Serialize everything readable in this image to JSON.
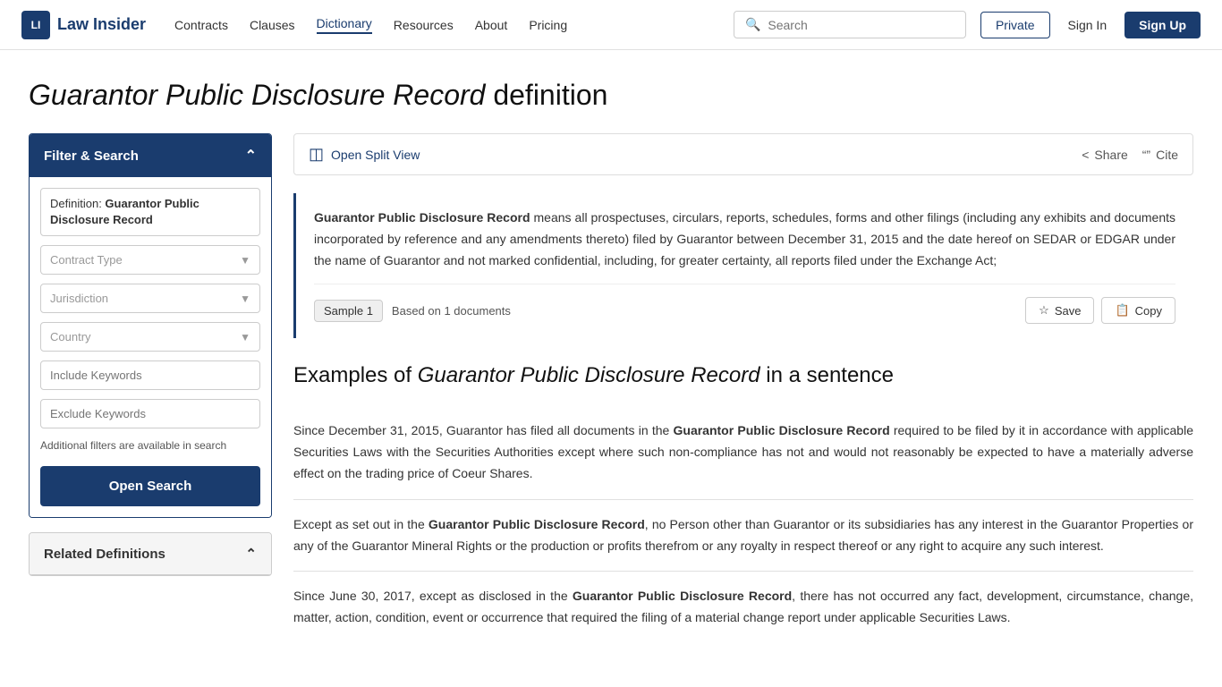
{
  "nav": {
    "logo_text": "Law Insider",
    "logo_icon": "LI",
    "links": [
      {
        "label": "Contracts",
        "active": false
      },
      {
        "label": "Clauses",
        "active": false
      },
      {
        "label": "Dictionary",
        "active": true
      },
      {
        "label": "Resources",
        "active": false
      },
      {
        "label": "About",
        "active": false
      },
      {
        "label": "Pricing",
        "active": false
      }
    ],
    "search_placeholder": "Search",
    "btn_private": "Private",
    "btn_signin": "Sign In",
    "btn_signup": "Sign Up"
  },
  "page_title_prefix": "",
  "page_title_italic": "Guarantor Public Disclosure Record",
  "page_title_suffix": " definition",
  "sidebar": {
    "filter_header": "Filter & Search",
    "definition_label": "Definition: ",
    "definition_value": "Guarantor Public Disclosure Record",
    "contract_type_placeholder": "Contract Type",
    "jurisdiction_placeholder": "Jurisdiction",
    "country_placeholder": "Country",
    "include_keywords_placeholder": "Include Keywords",
    "exclude_keywords_placeholder": "Exclude Keywords",
    "additional_filters": "Additional filters are available in search",
    "open_search_btn": "Open Search",
    "related_header": "Related Definitions"
  },
  "content": {
    "split_view_label": "Open Split View",
    "share_label": "Share",
    "cite_label": "Cite",
    "definition_bold": "Guarantor Public Disclosure Record",
    "definition_text": " means all prospectuses, circulars, reports, schedules, forms and other filings (including any exhibits and documents incorporated by reference and any amendments thereto) filed by Guarantor between December 31, 2015 and the date hereof on SEDAR or EDGAR under the name of Guarantor and not marked confidential, including, for greater certainty, all reports filed under the Exchange Act;",
    "sample_badge": "Sample 1",
    "based_on": "Based on 1 documents",
    "save_btn": "Save",
    "copy_btn": "Copy",
    "examples_heading_prefix": "Examples of ",
    "examples_heading_italic": "Guarantor Public Disclosure Record",
    "examples_heading_suffix": " in a sentence",
    "examples": [
      {
        "bold": "Guarantor Public Disclosure Record",
        "text_before": "Since December 31, 2015, Guarantor has filed all documents in the ",
        "text_after": " required to be filed by it in accordance with applicable Securities Laws with the Securities Authorities except where such non-compliance has not and would not reasonably be expected to have a materially adverse effect on the trading price of Coeur Shares."
      },
      {
        "bold": "Guarantor Public Disclosure Record",
        "text_before": "Except as set out in the ",
        "text_after": ", no Person other than Guarantor or its subsidiaries has any interest in the Guarantor Properties or any of the Guarantor Mineral Rights or the production or profits therefrom or any royalty in respect thereof or any right to acquire any such interest."
      },
      {
        "bold": "Guarantor Public Disclosure Record",
        "text_before": "Since June 30, 2017, except as disclosed in the ",
        "text_after": ", there has not occurred any fact, development, circumstance, change, matter, action, condition, event or occurrence that required the filing of a material change report under applicable Securities Laws."
      }
    ]
  }
}
